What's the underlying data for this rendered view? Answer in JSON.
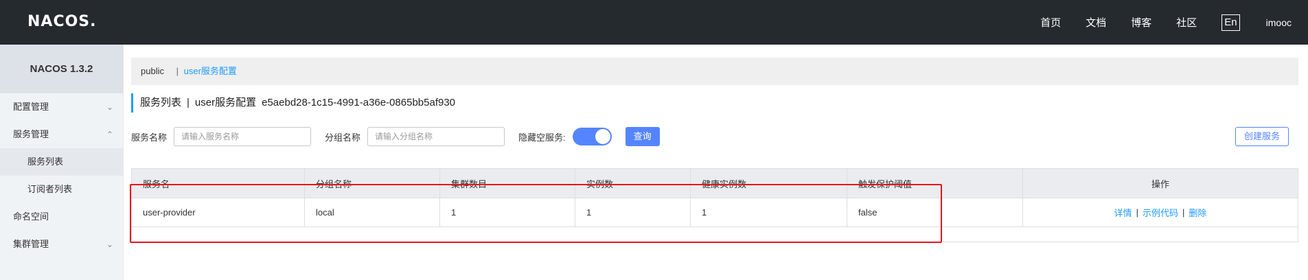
{
  "header": {
    "logo": "NACOS.",
    "nav": [
      "首页",
      "文档",
      "博客",
      "社区"
    ],
    "lang": "En",
    "user": "imooc"
  },
  "sidebar": {
    "version": "NACOS 1.3.2",
    "items": [
      {
        "label": "配置管理",
        "chevron": "chevron-down"
      },
      {
        "label": "服务管理",
        "chevron": "chevron-up"
      },
      {
        "label": "服务列表",
        "sub": true,
        "active": true
      },
      {
        "label": "订阅者列表",
        "sub": true
      },
      {
        "label": "命名空间"
      },
      {
        "label": "集群管理",
        "chevron": "chevron-down"
      }
    ]
  },
  "breadcrumb": {
    "namespace": "public",
    "separator": "|",
    "current": "user服务配置"
  },
  "title": {
    "prefix": "服务列表",
    "separator": "|",
    "namespace_name": "user服务配置",
    "namespace_id": "e5aebd28-1c15-4991-a36e-0865bb5af930"
  },
  "filters": {
    "service_label": "服务名称",
    "service_placeholder": "请输入服务名称",
    "group_label": "分组名称",
    "group_placeholder": "请输入分组名称",
    "hide_empty_label": "隐藏空服务:",
    "hide_empty_on": true,
    "query_button": "查询",
    "create_button": "创建服务"
  },
  "table": {
    "columns": [
      "服务名",
      "分组名称",
      "集群数目",
      "实例数",
      "健康实例数",
      "触发保护阈值",
      "操作"
    ],
    "rows": [
      {
        "service": "user-provider",
        "group": "local",
        "clusters": "1",
        "instances": "1",
        "healthy": "1",
        "threshold": "false",
        "actions": [
          "详情",
          "示例代码",
          "删除"
        ]
      }
    ]
  },
  "colors": {
    "header_bg": "#252a2f",
    "accent": "#5584ff",
    "link": "#209bfa",
    "highlight": "#e8141a"
  }
}
